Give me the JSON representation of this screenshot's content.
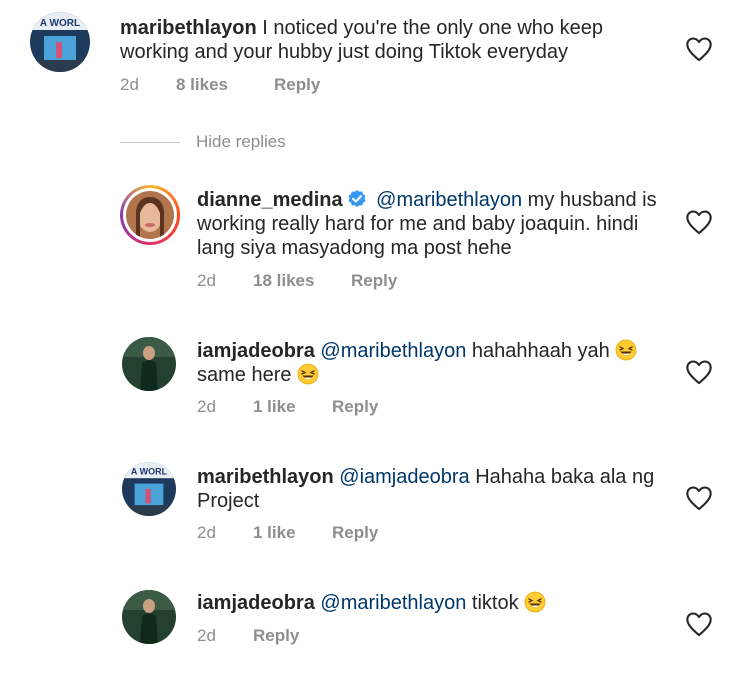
{
  "comments": [
    {
      "username": "maribethlayon",
      "mention": "",
      "text": "I noticed you're the only one who keep working and your hubby just doing Tiktok everyday",
      "time": "2d",
      "likes": "8 likes",
      "reply": "Reply",
      "avatar_text": "A WORL"
    },
    {
      "username": "dianne_medina",
      "verified": true,
      "mention": "@maribethlayon",
      "text": "my husband is working really hard for me and baby joaquin. hindi lang siya masyadong ma post hehe",
      "time": "2d",
      "likes": "18 likes",
      "reply": "Reply"
    },
    {
      "username": "iamjadeobra",
      "mention": "@maribethlayon",
      "text_before_emoji": "hahahhaah yah",
      "text_after_emoji": "same here",
      "time": "2d",
      "likes": "1 like",
      "reply": "Reply"
    },
    {
      "username": "maribethlayon",
      "mention": "@iamjadeobra",
      "text": "Hahaha baka ala ng Project",
      "time": "2d",
      "likes": "1 like",
      "reply": "Reply",
      "avatar_text": "A WORL"
    },
    {
      "username": "iamjadeobra",
      "mention": "@maribethlayon",
      "text": "tiktok",
      "time": "2d",
      "reply": "Reply"
    }
  ],
  "hide_replies_label": "Hide replies",
  "icons": {
    "like": "heart-outline-icon",
    "verified": "verified-badge-icon",
    "emoji": "laughing-emoji"
  },
  "colors": {
    "text": "#262626",
    "secondary": "#8e8e8e",
    "mention": "#00376b",
    "verified": "#3897f0"
  }
}
